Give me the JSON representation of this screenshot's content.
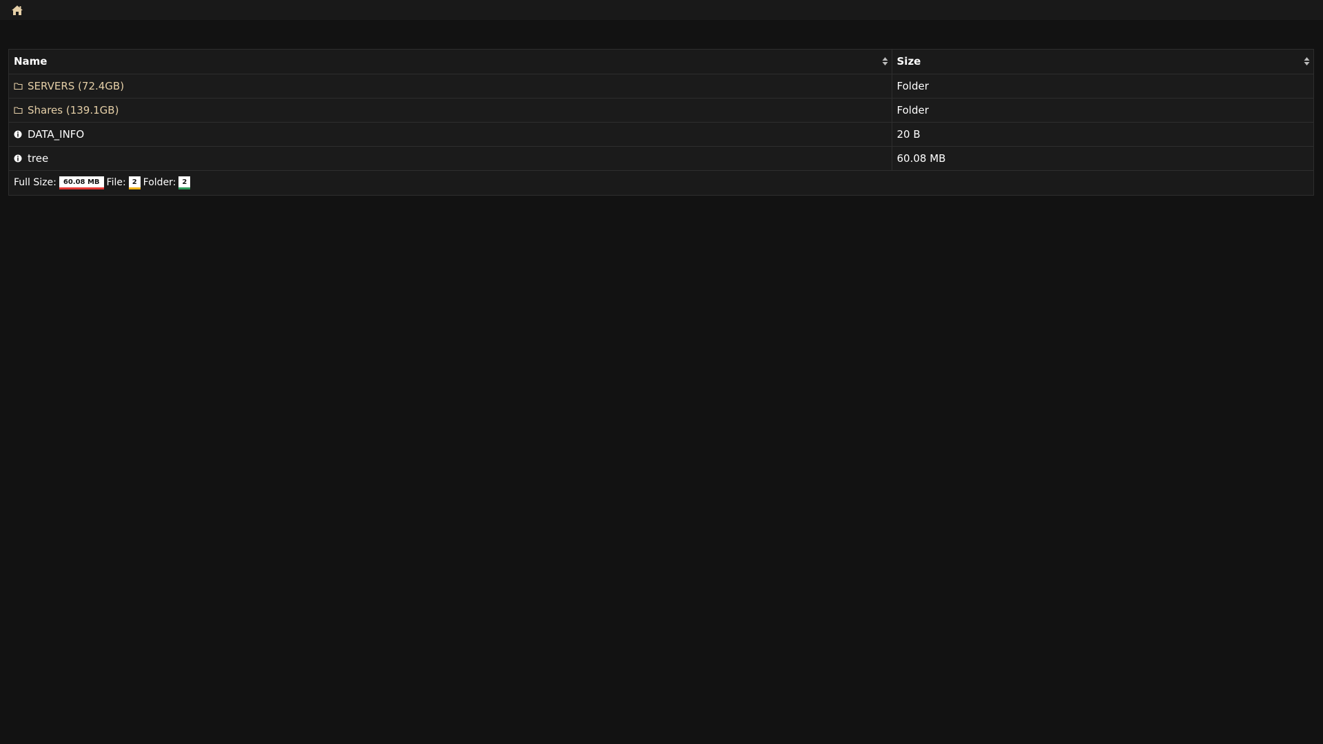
{
  "nav": {
    "home_icon": "home-icon",
    "accent_color": "#e5cfa7"
  },
  "table": {
    "headers": {
      "name": "Name",
      "size": "Size"
    },
    "rows": [
      {
        "icon": "folder-icon",
        "name": "SERVERS (72.4GB)",
        "size": "Folder",
        "type": "folder"
      },
      {
        "icon": "folder-icon",
        "name": "Shares (139.1GB)",
        "size": "Folder",
        "type": "folder"
      },
      {
        "icon": "info-icon",
        "name": "DATA_INFO",
        "size": "20 B",
        "type": "file"
      },
      {
        "icon": "info-icon",
        "name": "tree",
        "size": "60.08 MB",
        "type": "file"
      }
    ]
  },
  "footer": {
    "full_size_label": "Full Size:",
    "full_size_value": "60.08 MB",
    "file_label": "File:",
    "file_count": "2",
    "folder_label": "Folder:",
    "folder_count": "2",
    "colors": {
      "full_size": "#e53935",
      "file": "#f2b418",
      "folder": "#2e9a5a"
    }
  }
}
